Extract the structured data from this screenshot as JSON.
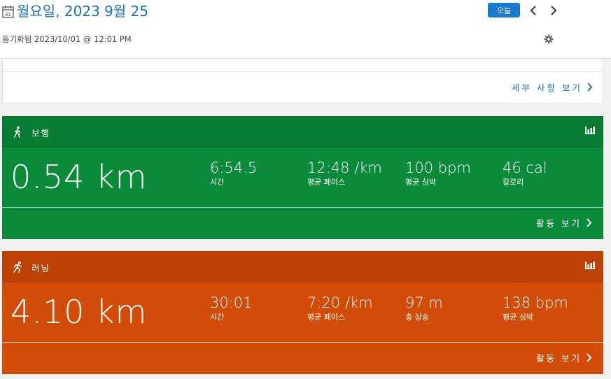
{
  "header": {
    "date_title": "월요일, 2023 9월 25",
    "today_label": "오늘",
    "sync_text": "동기화됨 2023/10/01 @ 12:01 PM",
    "calendar_day": "31",
    "accent_color": "#1a6fbd"
  },
  "details": {
    "link_label": "세부 사항 보기"
  },
  "activities": [
    {
      "name": "보행",
      "icon": "walking-icon",
      "color": "#0a8b3a",
      "distance": "0.54 km",
      "metrics": [
        {
          "value": "6:54.5",
          "label": "시간"
        },
        {
          "value": "12:48 /km",
          "label": "평균 페이스"
        },
        {
          "value": "100 bpm",
          "label": "평균 심박"
        },
        {
          "value": "46 cal",
          "label": "칼로리"
        }
      ],
      "link_label": "활동 보기"
    },
    {
      "name": "러닝",
      "icon": "running-icon",
      "color": "#d24c07",
      "distance": "4.10 km",
      "metrics": [
        {
          "value": "30:01",
          "label": "시간"
        },
        {
          "value": "7:20 /km",
          "label": "평균 페이스"
        },
        {
          "value": "97 m",
          "label": "총 상승"
        },
        {
          "value": "138 bpm",
          "label": "평균 심박"
        }
      ],
      "link_label": "활동 보기"
    }
  ]
}
